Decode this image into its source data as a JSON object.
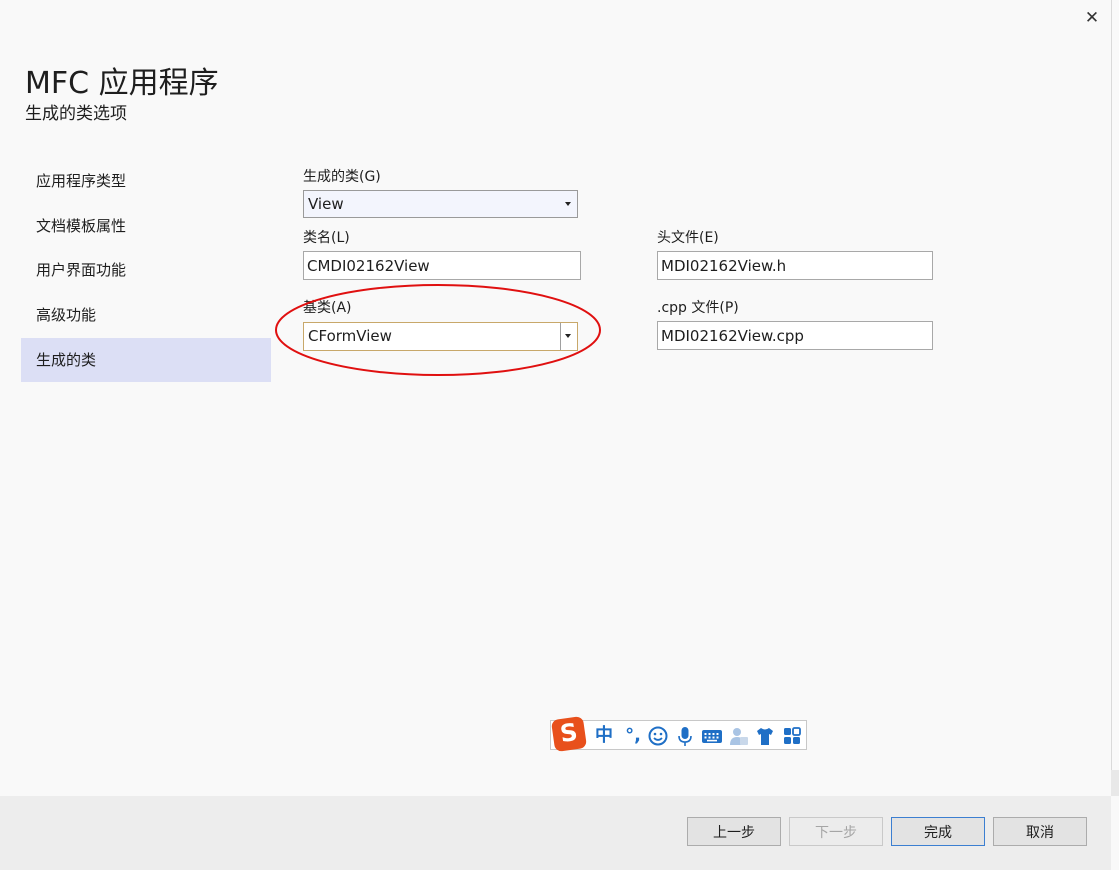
{
  "window": {
    "close_glyph": "✕",
    "title": "MFC 应用程序",
    "subtitle": "生成的类选项"
  },
  "nav": {
    "items": [
      {
        "label": "应用程序类型"
      },
      {
        "label": "文档模板属性"
      },
      {
        "label": "用户界面功能"
      },
      {
        "label": "高级功能"
      },
      {
        "label": "生成的类",
        "selected": true
      }
    ]
  },
  "form": {
    "generated_class": {
      "label": "生成的类(G)",
      "value": "View"
    },
    "class_name": {
      "label": "类名(L)",
      "value": "CMDI02162View"
    },
    "header_file": {
      "label": "头文件(E)",
      "value": "MDI02162View.h"
    },
    "base_class": {
      "label": "基类(A)",
      "value": "CFormView"
    },
    "cpp_file": {
      "label": ".cpp 文件(P)",
      "value": "MDI02162View.cpp"
    }
  },
  "annotation": {
    "color": "#e01010"
  },
  "ime_toolbar": {
    "logo": "S",
    "mode": "中",
    "punct": "°,",
    "icons": [
      "smiley-icon",
      "microphone-icon",
      "keyboard-icon",
      "user-icon",
      "tshirt-icon",
      "grid-icon"
    ],
    "accent": "#1f6fc6"
  },
  "footer": {
    "prev": "上一步",
    "next": "下一步",
    "finish": "完成",
    "cancel": "取消"
  }
}
